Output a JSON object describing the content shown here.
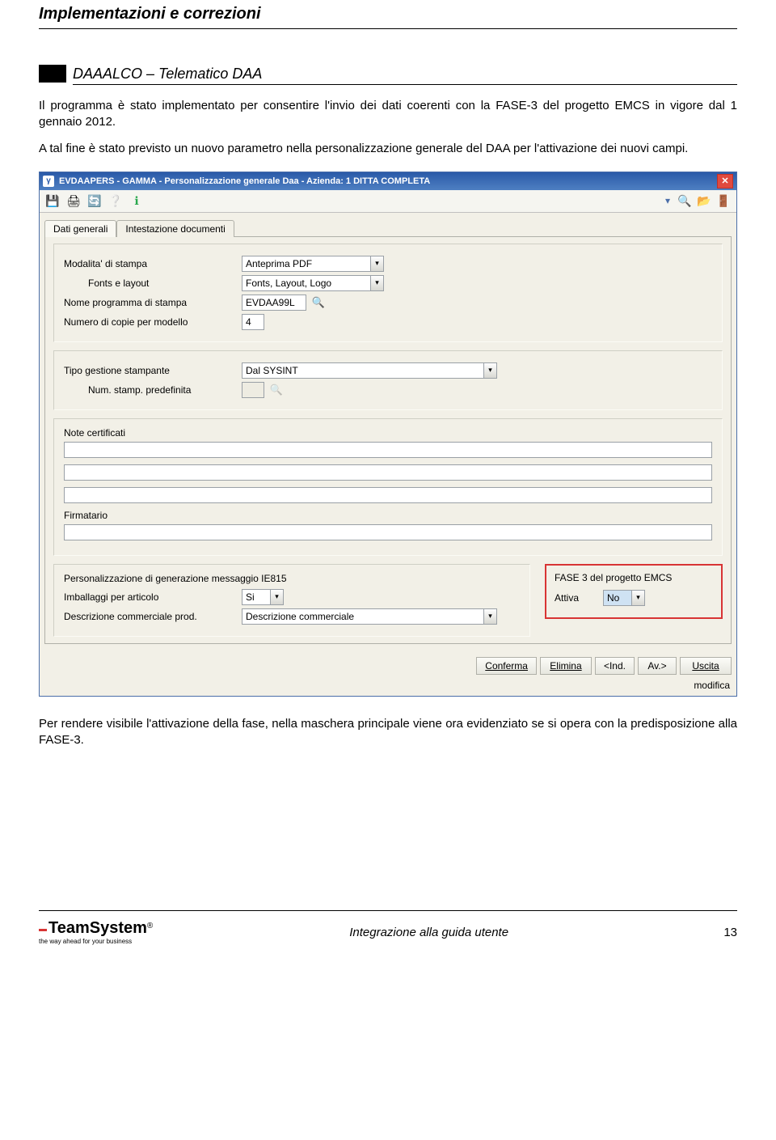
{
  "doc": {
    "header": "Implementazioni e correzioni",
    "section_title": "DAAALCO – Telematico DAA",
    "para1": "Il programma è stato implementato per consentire l'invio dei dati coerenti con la FASE-3 del progetto EMCS in vigore dal 1 gennaio 2012.",
    "para2": "A tal fine è stato previsto un nuovo parametro nella personalizzazione generale del DAA per l'attivazione dei nuovi campi.",
    "para3": "Per rendere visibile l'attivazione della fase, nella maschera principale viene ora evidenziato se si opera con la predisposizione alla FASE-3.",
    "footer_center": "Integrazione alla guida utente",
    "footer_page": "13",
    "footer_logo": "TeamSystem",
    "footer_tagline": "the way ahead for your business"
  },
  "win": {
    "title": "EVDAAPERS - GAMMA - Personalizzazione generale Daa - Azienda:    1 DITTA COMPLETA",
    "tabs": {
      "t1": "Dati generali",
      "t2": "Intestazione documenti"
    },
    "fields": {
      "modalita_label": "Modalita' di stampa",
      "modalita_value": "Anteprima PDF",
      "fonts_label": "Fonts e layout",
      "fonts_value": "Fonts, Layout, Logo",
      "nomeprog_label": "Nome programma di stampa",
      "nomeprog_value": "EVDAA99L",
      "copie_label": "Numero di copie per modello",
      "copie_value": "4",
      "tipogest_label": "Tipo gestione stampante",
      "tipogest_value": "Dal SYSINT",
      "numstamp_label": "Num. stamp. predefinita",
      "numstamp_value": "",
      "notecert_label": "Note certificati",
      "firm_label": "Firmatario",
      "ie815_label": "Personalizzazione di generazione messaggio IE815",
      "imballaggi_label": "Imballaggi per articolo",
      "imballaggi_value": "Si",
      "descr_label": "Descrizione commerciale prod.",
      "descr_value": "Descrizione commerciale",
      "fase_title": "FASE 3 del progetto EMCS",
      "attiva_label": "Attiva",
      "attiva_value": "No"
    },
    "buttons": {
      "conferma": "Conferma",
      "elimina": "Elimina",
      "ind": "<Ind.",
      "av": "Av.>",
      "uscita": "Uscita"
    },
    "status": "modifica"
  }
}
